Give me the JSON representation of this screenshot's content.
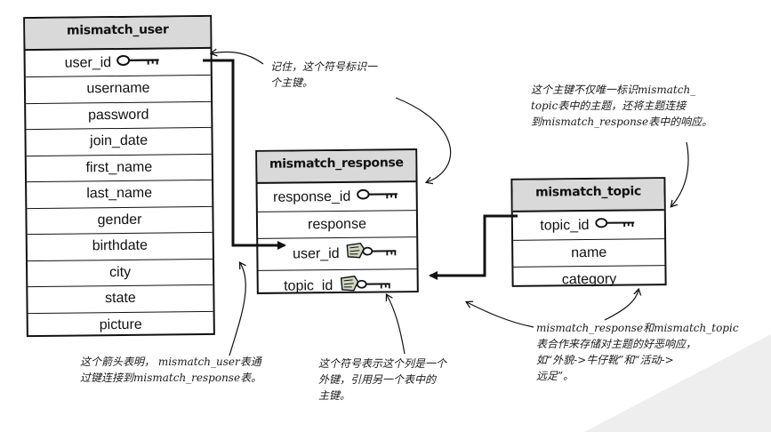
{
  "tables": {
    "user": {
      "title": "mismatch_user",
      "key_field": "user_id",
      "fields": [
        "username",
        "password",
        "join_date",
        "first_name",
        "last_name",
        "gender",
        "birthdate",
        "city",
        "state",
        "picture"
      ]
    },
    "response": {
      "title": "mismatch_response",
      "key_field": "response_id",
      "fields": [
        "response",
        "user_id",
        "topic_id"
      ]
    },
    "topic": {
      "title": "mismatch_topic",
      "key_field": "topic_id",
      "fields": [
        "name",
        "category"
      ]
    }
  },
  "notes": {
    "primary_key": "记住，这个符号标识一\n个主键。",
    "topic_key": "这个主键不仅唯一标识mismatch_\ntopic表中的主题，还将主题连接\n到mismatch_response表中的响应。",
    "arrow": "这个箭头表明，  mismatch_user表通\n过键连接到mismatch_response表。",
    "foreign_key": "这个符号表示这个列是一个\n外键，引用另一个表中的\n主键。",
    "combo": "mismatch_response和mismatch_topic\n表合作来存储对主题的好恶响应，\n如“外貌->牛仔靴”和“活动->\n远足”。"
  },
  "icons": {
    "primary_key": "key-icon",
    "foreign_key": "tagged-key-icon"
  }
}
